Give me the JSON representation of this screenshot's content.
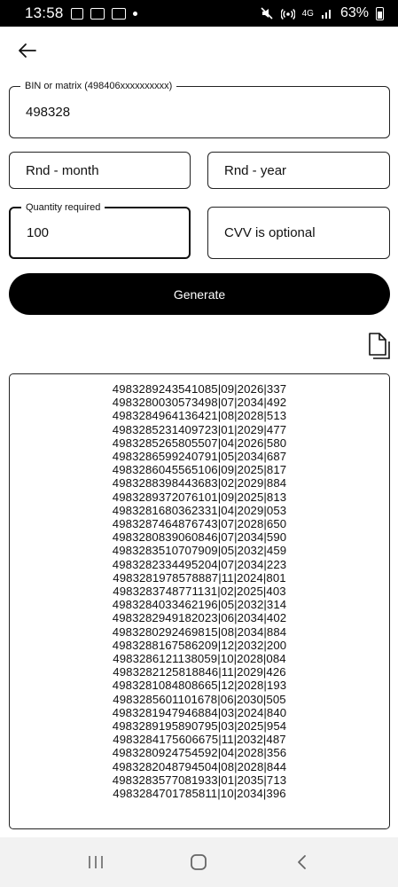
{
  "status_bar": {
    "time": "13:58",
    "network": "4G",
    "battery": "63%",
    "icons": [
      "image-icon",
      "card-icon",
      "card-icon",
      "dot-icon",
      "mute-icon",
      "hotspot-icon",
      "signal-icon",
      "battery-icon"
    ]
  },
  "nav": {
    "back_icon": "arrow-left-icon"
  },
  "form": {
    "bin": {
      "label": "BIN or matrix (498406xxxxxxxxxx)",
      "value": "498328"
    },
    "month": {
      "value": "Rnd - month"
    },
    "year": {
      "value": "Rnd - year"
    },
    "quantity": {
      "label": "Quantity required",
      "value": "100"
    },
    "cvv": {
      "value": "CVV is optional"
    },
    "generate_label": "Generate",
    "copy_icon": "copy-icon"
  },
  "results": [
    "4983289243541085|09|2026|337",
    "4983280030573498|07|2034|492",
    "4983284964136421|08|2028|513",
    "4983285231409723|01|2029|477",
    "4983285265805507|04|2026|580",
    "4983286599240791|05|2034|687",
    "4983286045565106|09|2025|817",
    "4983288398443683|02|2029|884",
    "4983289372076101|09|2025|813",
    "4983281680362331|04|2029|053",
    "4983287464876743|07|2028|650",
    "4983280839060846|07|2034|590",
    "4983283510707909|05|2032|459",
    "4983282334495204|07|2034|223",
    "4983281978578887|11|2024|801",
    "4983283748771131|02|2025|403",
    "4983284033462196|05|2032|314",
    "4983282949182023|06|2034|402",
    "4983280292469815|08|2034|884",
    "4983288167586209|12|2032|200",
    "4983286121138059|10|2028|084",
    "4983282125818846|11|2029|426",
    "4983281084808665|12|2028|193",
    "4983285601101678|06|2030|505",
    "4983281947946884|03|2024|840",
    "4983289195890795|03|2025|954",
    "4983284175606675|11|2032|487",
    "4983280924754592|04|2028|356",
    "4983282048794504|08|2028|844",
    "4983283577081933|01|2035|713",
    "4983284701785811|10|2034|396"
  ],
  "bottom_nav": {
    "recents_icon": "recents-icon",
    "home_icon": "home-icon",
    "back_icon": "back-chevron-icon"
  }
}
